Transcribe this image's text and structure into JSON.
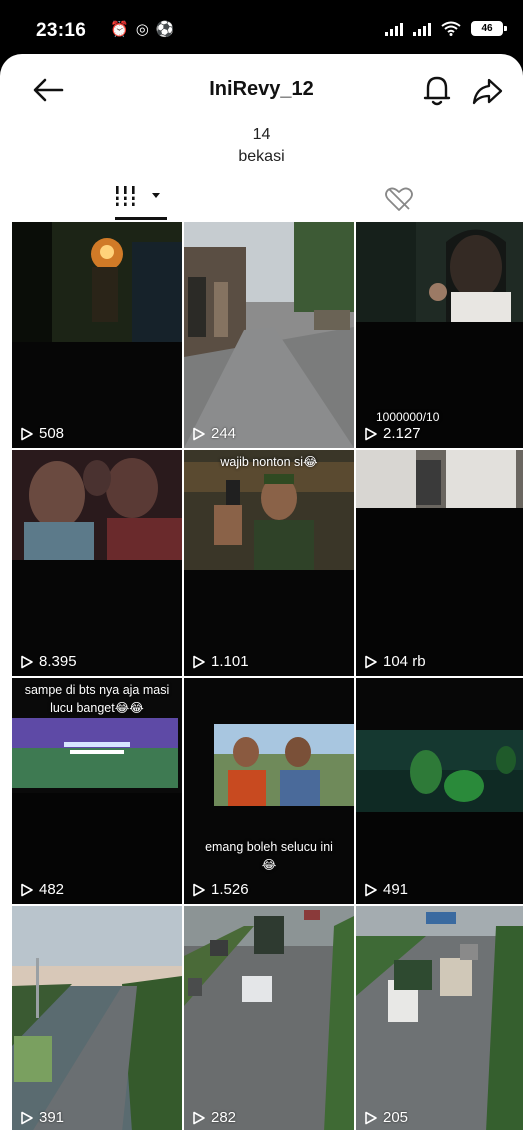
{
  "status_bar": {
    "time": "23:16",
    "battery": "46"
  },
  "header": {
    "title": "IniRevy_12"
  },
  "profile": {
    "video_count": "14",
    "location": "bekasi"
  },
  "tabs": [
    {
      "name": "grid",
      "active": true
    },
    {
      "name": "liked",
      "active": false
    }
  ],
  "videos": [
    {
      "views": "508"
    },
    {
      "views": "244"
    },
    {
      "views": "2.127",
      "overlay": "1000000/10"
    },
    {
      "views": "8.395"
    },
    {
      "views": "1.101",
      "caption": "wajib nonton si😂"
    },
    {
      "views": "104 rb"
    },
    {
      "views": "482",
      "caption_line1": "sampe di bts nya aja masi",
      "caption_line2": "lucu banget😂😂"
    },
    {
      "views": "1.526",
      "caption_line1": "emang boleh selucu ini",
      "caption_line2": "😂"
    },
    {
      "views": "491"
    },
    {
      "views": "391"
    },
    {
      "views": "282"
    },
    {
      "views": "205"
    }
  ],
  "colors": {
    "accent_dark": "#111111",
    "background": "#ffffff",
    "status_bar": "#000000"
  }
}
